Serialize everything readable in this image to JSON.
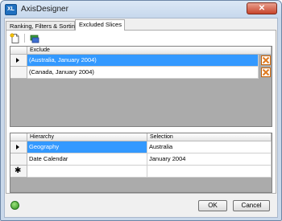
{
  "window": {
    "title": "AxisDesigner",
    "app_icon_text": "XL"
  },
  "tabs": [
    {
      "label": "Ranking, Filters & Sorting"
    },
    {
      "label": "Excluded Slices"
    }
  ],
  "exclude_grid": {
    "header": "Exclude",
    "rows": [
      {
        "value": "(Australia, January 2004)",
        "selected": true
      },
      {
        "value": "(Canada, January 2004)",
        "selected": false
      }
    ]
  },
  "slice_grid": {
    "headers": [
      "Hierarchy",
      "Selection"
    ],
    "rows": [
      {
        "hierarchy": "Geography",
        "selection": "Australia"
      },
      {
        "hierarchy": "Date Calendar",
        "selection": "January 2004"
      }
    ],
    "new_row_marker": "✱"
  },
  "buttons": {
    "ok": "OK",
    "cancel": "Cancel"
  },
  "icons": {
    "toolbar_new": "new-page-icon",
    "toolbar_add": "add-slice-icon",
    "row_delete": "delete-x-icon",
    "help": "help-icon",
    "close": "close-icon"
  },
  "colors": {
    "selection": "#3399ff",
    "delete_accent": "#e07a1f",
    "close_button": "#c7442b"
  }
}
